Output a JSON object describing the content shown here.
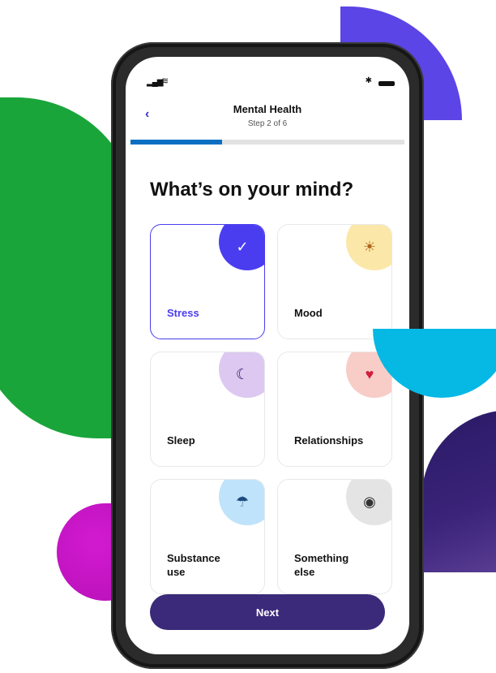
{
  "colors": {
    "accent": "#4a3df0",
    "progress": "#0a6fc2",
    "button": "#3b2a7a"
  },
  "nav": {
    "back_icon": "chevron-left-icon",
    "title": "Mental Health",
    "step": "Step 2 of 6"
  },
  "progress": {
    "current_step": 2,
    "total_steps": 6
  },
  "heading": "What’s on your mind?",
  "options": [
    {
      "label": "Stress",
      "icon": "check-icon",
      "selected": true
    },
    {
      "label": "Mood",
      "icon": "sun-icon",
      "selected": false
    },
    {
      "label": "Sleep",
      "icon": "moon-icon",
      "selected": false
    },
    {
      "label": "Relationships",
      "icon": "heart-icon",
      "selected": false
    },
    {
      "label": "Substance use",
      "icon": "umbrella-icon",
      "selected": false
    },
    {
      "label": "Something else",
      "icon": "circle-icon",
      "selected": false
    }
  ],
  "next_label": "Next"
}
